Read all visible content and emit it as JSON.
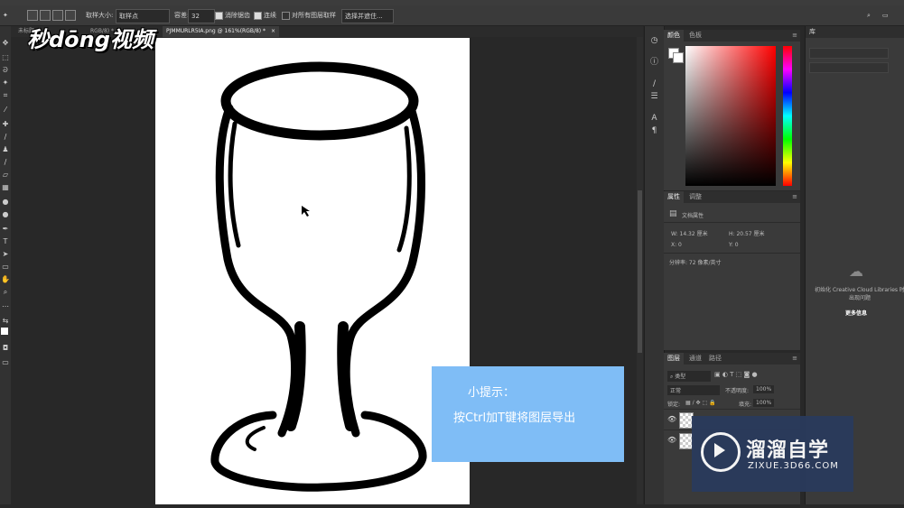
{
  "logo_text": "秒dōng视频",
  "options_bar": {
    "sample_size_label": "取样大小:",
    "sample_size_value": "取样点",
    "tolerance_label": "容差:",
    "tolerance_value": "32",
    "anti_alias_label": "消除锯齿",
    "contiguous_label": "连续",
    "sample_all_label": "对所有图层取样",
    "select_subject_label": "选择并遮住..."
  },
  "tabs": [
    {
      "label": "未标题"
    },
    {
      "label": "RGB/8) *"
    },
    {
      "label": "PJMMURLR5IA.png @ 161%(RGB/8) *"
    }
  ],
  "hint": {
    "line1": "小提示：",
    "line2": "按Ctrl加T键将图层导出"
  },
  "color_panel": {
    "tab1": "颜色",
    "tab2": "色板"
  },
  "properties_panel": {
    "tab1": "属性",
    "tab2": "调整",
    "doc_props": "文档属性",
    "w": "W:  14.32  厘米",
    "h": "H:  20.57  厘米",
    "x": "X:  0",
    "y": "Y:  0",
    "resolution": "分辨率: 72 像素/英寸"
  },
  "layers_panel": {
    "tab1": "图层",
    "tab2": "通道",
    "tab3": "路径",
    "kind": "类型",
    "blend": "正常",
    "opacity_label": "不透明度:",
    "opacity": "100%",
    "lock_label": "锁定:",
    "fill_label": "填充:",
    "fill": "100%"
  },
  "library_panel": {
    "tab": "库",
    "message": "初始化 Creative Cloud Libraries 时出现问题",
    "more_info": "更多信息"
  },
  "watermark": {
    "cn": "溜溜自学",
    "en": "ZIXUE.3D66.COM"
  }
}
